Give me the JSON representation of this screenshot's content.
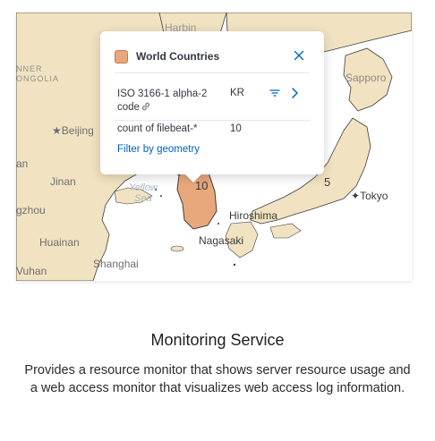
{
  "map": {
    "labels": {
      "harbin": "Harbin",
      "inner_mongolia": "NNER\nONGOLIA",
      "beijing": "Beijing",
      "an": "an",
      "jinan": "Jinan",
      "zhou": "gzhou",
      "yellow_sea": "Yellow\nSea",
      "huainan": "Huainan",
      "wuhan": "Vuhan",
      "shanghai": "Shanghai",
      "sapporo": "Sapporo",
      "tokyo": "Tokyo",
      "hiroshima": "Hiroshima",
      "nagasaki": "Nagasaki"
    },
    "counts": {
      "korea": "10",
      "japan": "5"
    },
    "colors": {
      "land": "#f1e3c1",
      "border": "#3d3d3d",
      "water": "#ffffff",
      "highlight": "#e8a87c"
    }
  },
  "popup": {
    "layer_icon": "layer-swatch-icon",
    "title": "World Countries",
    "close_icon": "close-icon",
    "rows": [
      {
        "key": "ISO 3166-1 alpha-2 code",
        "value": "KR",
        "icons": [
          "link-icon",
          "filter-icon",
          "chevron-right-icon"
        ]
      },
      {
        "key": "count of filebeat-*",
        "value": "10"
      }
    ],
    "filter_link": "Filter by geometry"
  },
  "content": {
    "title": "Monitoring Service",
    "description": "Provides a resource monitor that shows server resource usage and a web access monitor that visualizes web access log information."
  }
}
